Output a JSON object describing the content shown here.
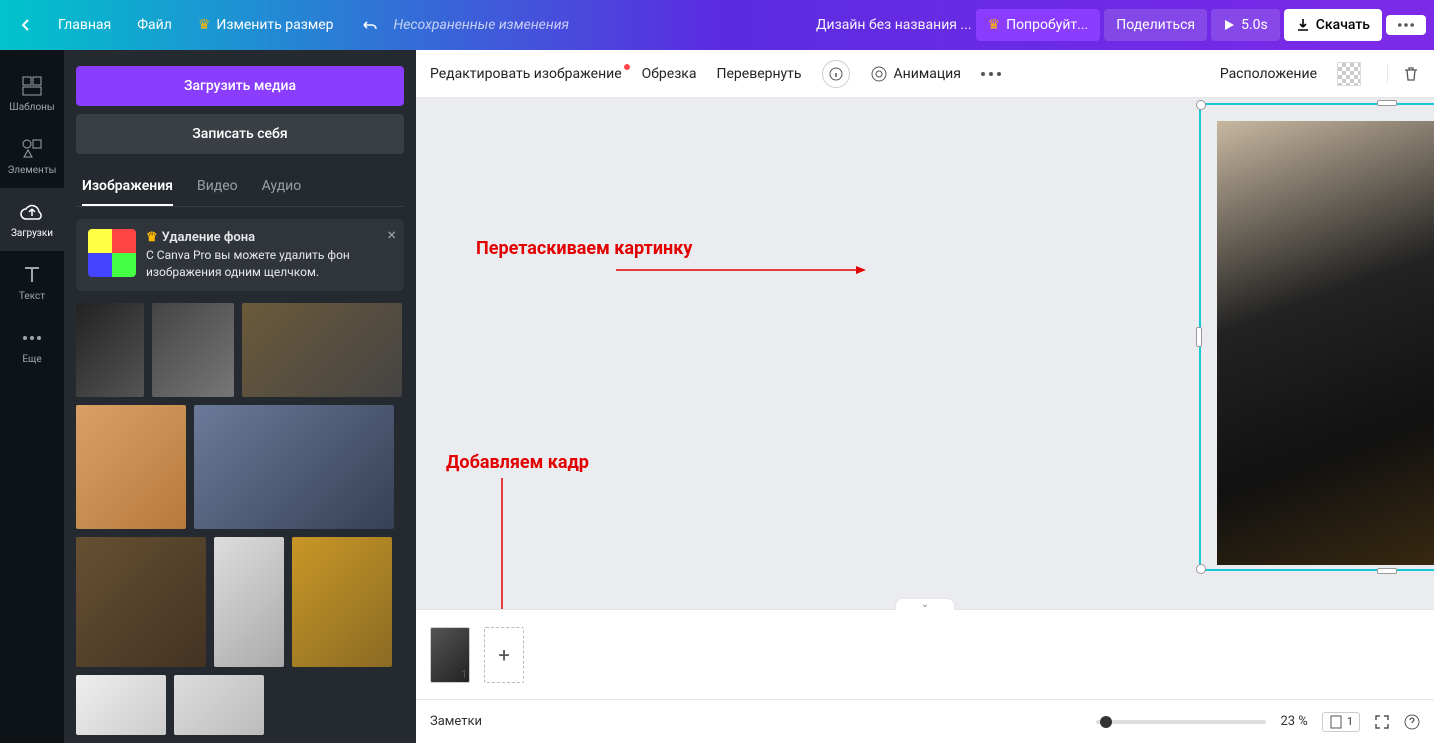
{
  "topbar": {
    "home": "Главная",
    "file": "Файл",
    "resize": "Изменить размер",
    "unsaved": "Несохраненные изменения",
    "doc_title": "Дизайн без названия ...",
    "try_pro": "Попробуйт...",
    "share": "Поделиться",
    "duration": "5.0s",
    "download": "Скачать"
  },
  "rail": {
    "templates": "Шаблоны",
    "elements": "Элементы",
    "uploads": "Загрузки",
    "text": "Текст",
    "more": "Еще"
  },
  "panel": {
    "upload": "Загрузить медиа",
    "record": "Записать себя",
    "tabs": {
      "images": "Изображения",
      "video": "Видео",
      "audio": "Аудио"
    },
    "promo": {
      "title": "Удаление фона",
      "desc": "С Canva Pro вы можете удалить фон изображения одним щелчком."
    }
  },
  "ctx": {
    "edit_image": "Редактировать изображение",
    "crop": "Обрезка",
    "flip": "Перевернуть",
    "animation": "Анимация",
    "position": "Расположение"
  },
  "annotations": {
    "drag": "Перетаскиваем картинку",
    "add": "Добавляем кадр"
  },
  "footer": {
    "notes": "Заметки",
    "zoom": "23 %",
    "page_badge": "1"
  },
  "reel": {
    "page_num": "1"
  }
}
